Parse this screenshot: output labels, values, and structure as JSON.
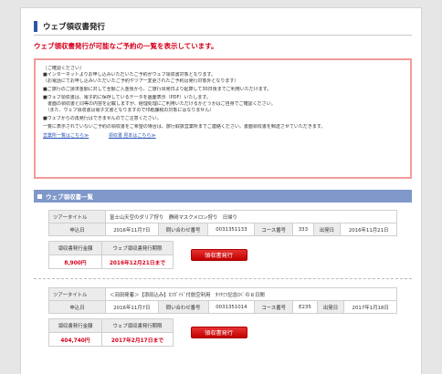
{
  "page_title": "ウェブ領収書発行",
  "lead": "ウェブ領収書発行が可能なご予約の一覧を表示しています。",
  "notice": {
    "heading": "［ご確認ください］",
    "lines": [
      "■インターネットよりお申し込みいただいたご予約がウェブ領収書対象となります。",
      "（お電話にてお申し込みいただいたご予約やツアー変更されたご予約は発行対象外となります）",
      "",
      "■ご旅行のご請求金額に対して全額ご入金後から、ご旅行出発日より起算して30日後までご利用いただけます。",
      "",
      "■ウェブ領収書は、電子的に保存しているデータを画面表示（PDF）いたします。",
      "　書面の領収書と同等の内容を記載しますが、経理処理にご利用いただけるかどうかはご自身でご確認ください。",
      "　（また、ウェブ領収書は電子文書となりますので印紙課税の対象にはなりません）",
      "",
      "■ウェブからの再発行はできませんのでご注意ください。",
      "",
      "一覧に表示されていないご予約の領収書をご希望の場合は、旅行取扱営業所までご連絡ください。書面領収書を郵送させていただきます。"
    ],
    "link_office": "営業所一覧はこちら≫",
    "link_sample": "領収書 見本はこちら≫"
  },
  "section_title": "ウェブ領収書一覧",
  "labels": {
    "tour_title": "ツアータイトル",
    "apply_date": "申込日",
    "inquiry_no": "問い合わせ番号",
    "course_no": "コース番号",
    "depart_date": "出発日",
    "amount": "領収書発行金額",
    "deadline": "ウェブ領収書発行期限",
    "issue_button": "領収書発行"
  },
  "bookings": [
    {
      "tour_title": "富士山天空のダリア狩り　静岡マスクメロン狩り　日帰り",
      "apply_date": "2016年11月7日",
      "inquiry_no": "0031351133",
      "course_no": "333",
      "depart_date": "2016年11月21日",
      "amount": "8,900円",
      "deadline": "2016年12月21日まで"
    },
    {
      "tour_title": "＜羽田発着＞【添田込み】ｶﾌｶﾞｲﾄﾞ付航空利用　ﾀｲﾔﾐﾂ記念ﾛﾍﾞの８日間",
      "apply_date": "2016年11月7日",
      "inquiry_no": "0031351014",
      "course_no": "E235",
      "depart_date": "2017年1月18日",
      "amount": "404,740円",
      "deadline": "2017年2月17日まで"
    }
  ]
}
